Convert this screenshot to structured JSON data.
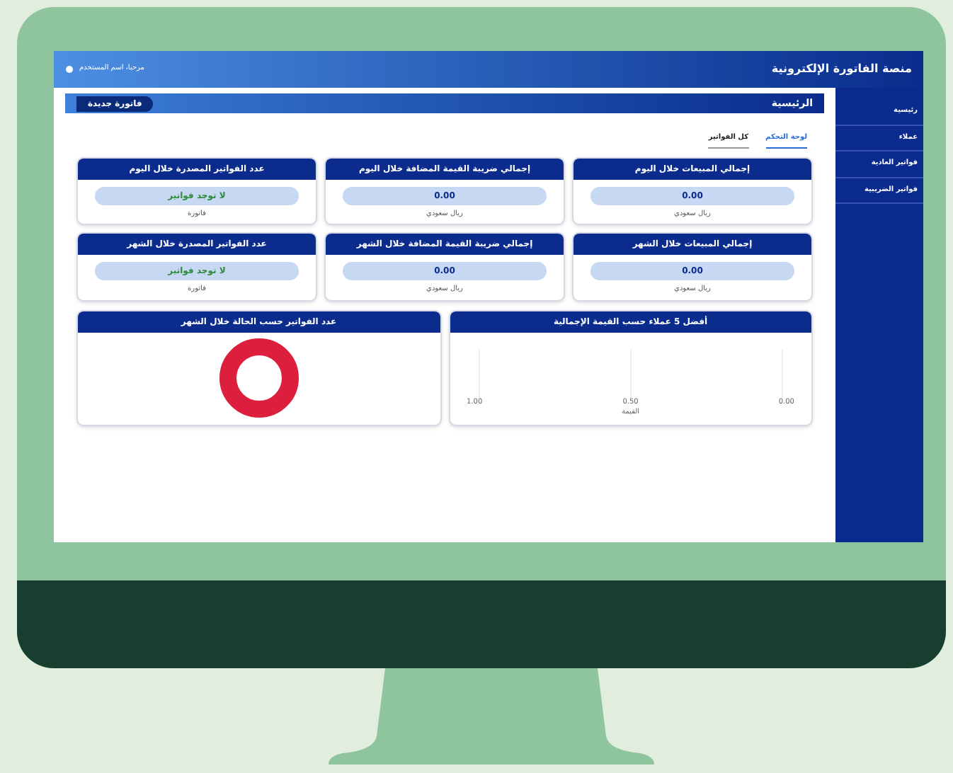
{
  "header": {
    "title": "منصة الفاتورة الإلكترونية",
    "user": "مرحبا، اسم المستخدم"
  },
  "sidebar": {
    "items": [
      {
        "label": "رئيسية"
      },
      {
        "label": "عملاء"
      },
      {
        "label": "فواتير العادية"
      },
      {
        "label": "فواتير الضريبية"
      }
    ]
  },
  "page": {
    "title": "الرئيسية",
    "new_button": "فاتورة جديدة"
  },
  "tabs": [
    {
      "label": "لوحة التحكم",
      "selected": true
    },
    {
      "label": "كل الفواتير",
      "selected": false
    }
  ],
  "cards": [
    {
      "title": "إجمالي المبيعات خلال اليوم",
      "value": "0.00",
      "unit": "ريال سعودي",
      "kind": "amount"
    },
    {
      "title": "إجمالي ضريبة القيمة المضافة خلال اليوم",
      "value": "0.00",
      "unit": "ريال سعودي",
      "kind": "amount"
    },
    {
      "title": "عدد الفواتير المصدرة خلال اليوم",
      "value": "لا توجد فواتير",
      "unit": "فاتورة",
      "kind": "count"
    },
    {
      "title": "إجمالي المبيعات خلال الشهر",
      "value": "0.00",
      "unit": "ريال سعودي",
      "kind": "amount"
    },
    {
      "title": "إجمالي ضريبة القيمة المضافة خلال الشهر",
      "value": "0.00",
      "unit": "ريال سعودي",
      "kind": "amount"
    },
    {
      "title": "عدد الفواتير المصدرة خلال الشهر",
      "value": "لا توجد فواتير",
      "unit": "فاتورة",
      "kind": "count"
    }
  ],
  "charts": [
    {
      "kind": "bar",
      "title": "أفضل 5 عملاء حسب القيمة الإجمالية",
      "tick_labels": [
        "0.00",
        "0.50",
        "1.00"
      ],
      "axis_title": "القيمة"
    },
    {
      "kind": "donut",
      "title": "عدد الفواتير حسب الحالة خلال الشهر"
    }
  ]
}
